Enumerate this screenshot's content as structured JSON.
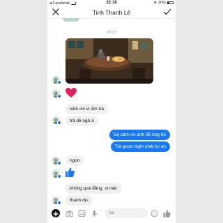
{
  "status_bar": {
    "back_app": "Facebook",
    "time": "22:18",
    "battery_level": 0.3,
    "battery_text": "30%"
  },
  "header": {
    "title": "Tinh Thanh Lê"
  },
  "conversation": {
    "timestamp": "20:13",
    "messages": [
      {
        "side": "in",
        "text": "cảm ơn vì ấm trà"
      },
      {
        "side": "in",
        "text": "trà dễ ngủ á"
      },
      {
        "side": "out",
        "text": "Dạ cảm ơn anh đã ủng hộ"
      },
      {
        "side": "out",
        "text": "Trà good night phải ko an"
      },
      {
        "side": "in",
        "text": "ngon"
      },
      {
        "side": "in",
        "text": "không quá đăng, vị mát"
      },
      {
        "side": "in",
        "text": "thanh dịu"
      }
    ]
  },
  "composer": {
    "placeholder": "Aa"
  },
  "colors": {
    "accent": "#1877f2",
    "incoming_bubble": "#f1f0f0",
    "heart": "#e0245e"
  }
}
